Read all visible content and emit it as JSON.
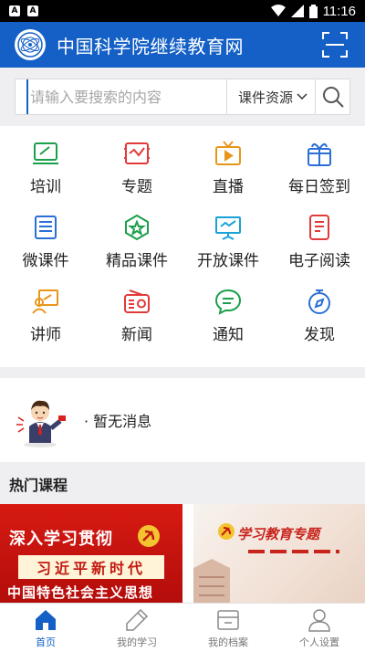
{
  "status_bar": {
    "time": "11:16",
    "left_icons": [
      "A",
      "A"
    ]
  },
  "app_bar": {
    "title": "中国科学院继续教育网"
  },
  "search": {
    "placeholder": "请输入要搜索的内容",
    "type_label": "课件资源"
  },
  "grid_items": [
    {
      "label": "培训",
      "icon": "training-icon",
      "color": "#1aa04a"
    },
    {
      "label": "专题",
      "icon": "topic-icon",
      "color": "#e23a3a"
    },
    {
      "label": "直播",
      "icon": "live-icon",
      "color": "#e8961a"
    },
    {
      "label": "每日签到",
      "icon": "checkin-icon",
      "color": "#2b6fd6"
    },
    {
      "label": "微课件",
      "icon": "micro-course-icon",
      "color": "#2b6fd6"
    },
    {
      "label": "精品课件",
      "icon": "premium-course-icon",
      "color": "#1aa04a"
    },
    {
      "label": "开放课件",
      "icon": "open-course-icon",
      "color": "#18a2d8"
    },
    {
      "label": "电子阅读",
      "icon": "ereading-icon",
      "color": "#e23a3a"
    },
    {
      "label": "讲师",
      "icon": "lecturer-icon",
      "color": "#e8961a"
    },
    {
      "label": "新闻",
      "icon": "news-icon",
      "color": "#e23a3a"
    },
    {
      "label": "通知",
      "icon": "notice-icon",
      "color": "#1aa04a"
    },
    {
      "label": "发现",
      "icon": "discover-icon",
      "color": "#2b6fd6"
    }
  ],
  "notice": {
    "text": "· 暂无消息"
  },
  "hot_courses": {
    "title": "热门课程",
    "card1": {
      "line1": "深入学习贯彻",
      "line2": "习近平新时代",
      "line3": "中国特色社会主义思想"
    },
    "card2": {
      "title": "学习教育专题"
    }
  },
  "tabs": [
    {
      "label": "首页",
      "icon": "home-icon",
      "active": true
    },
    {
      "label": "我的学习",
      "icon": "pen-icon",
      "active": false
    },
    {
      "label": "我的档案",
      "icon": "archive-icon",
      "active": false
    },
    {
      "label": "个人设置",
      "icon": "user-icon",
      "active": false
    }
  ],
  "colors": {
    "primary": "#1460c6",
    "background": "#efeff1"
  }
}
